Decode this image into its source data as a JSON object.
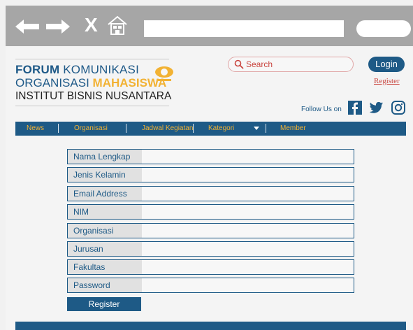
{
  "browser": {
    "back_icon": "left-arrow-icon",
    "forward_icon": "right-arrow-icon",
    "close_label": "X",
    "home_icon": "home-icon"
  },
  "brand": {
    "line1_bold": "FORUM",
    "line1_rest": " KOMUNIKASI",
    "line2_normal": "ORGANISASI ",
    "line2_bold": "MAHASISWA",
    "line3": "INSTITUT BISNIS NUSANTARA",
    "colors": {
      "primary": "#1e5a86",
      "accent": "#f2b233"
    }
  },
  "header": {
    "search_placeholder": "Search",
    "login_label": "Login",
    "register_link": "Register",
    "follow_label": "Follow Us on",
    "social": [
      "facebook-icon",
      "twitter-icon",
      "instagram-icon"
    ]
  },
  "nav": {
    "items": [
      "News",
      "Organisasi",
      "Jadwal Kegiatan",
      "Kategori",
      "Member"
    ]
  },
  "form": {
    "fields": [
      "Nama Lengkap",
      "Jenis Kelamin",
      "Email Address",
      "NIM",
      "Organisasi",
      "Jurusan",
      "Fakultas",
      "Password"
    ],
    "submit_label": "Register"
  }
}
